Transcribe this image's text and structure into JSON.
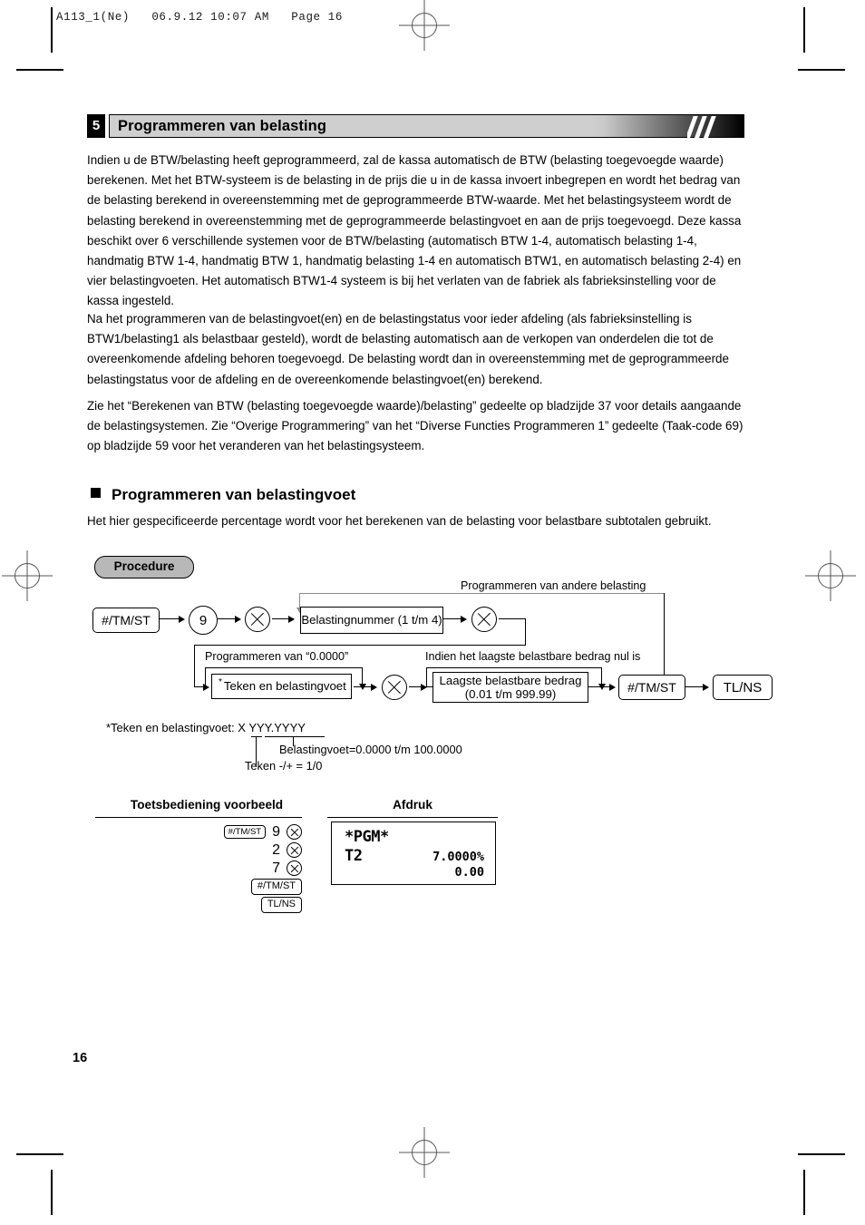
{
  "print_header": {
    "text": "A113_1(Ne)   06.9.12 10:07 AM   Page 16"
  },
  "section": {
    "number": "5",
    "title": "Programmeren van belasting"
  },
  "paragraphs": {
    "p1": "Indien u de BTW/belasting heeft geprogrammeerd, zal de kassa automatisch de BTW (belasting toegevoegde waarde) berekenen. Met het BTW-systeem is de belasting in de prijs die u in de kassa invoert inbegrepen en wordt het bedrag van de belasting berekend in overeenstemming met de geprogrammeerde BTW-waarde. Met het belastingsysteem wordt de belasting berekend in overeenstemming met de geprogrammeerde belastingvoet en aan de prijs toegevoegd. Deze kassa beschikt over 6 verschillende systemen voor de BTW/belasting (automatisch BTW 1-4, automatisch belasting 1-4, handmatig BTW 1-4, handmatig BTW 1, handmatig belasting 1-4 en automatisch BTW1, en automatisch belasting 2-4) en vier belastingvoeten. Het automatisch BTW1-4 systeem is bij het verlaten van de fabriek als fabrieksinstelling voor de kassa ingesteld.",
    "p2": "Na het programmeren van de belastingvoet(en) en de belastingstatus voor ieder afdeling (als fabrieksinstelling is BTW1/belasting1 als belastbaar gesteld), wordt de belasting automatisch aan de verkopen van onderdelen die tot de overeenkomende afdeling behoren toegevoegd. De belasting wordt dan in overeenstemming met de geprogrammeerde belastingstatus voor de afdeling en de overeenkomende belastingvoet(en) berekend.",
    "p3": "Zie het “Berekenen van BTW (belasting toegevoegde waarde)/belasting” gedeelte op bladzijde 37 voor details aangaande de belastingsystemen. Zie “Overige Programmering” van het “Diverse Functies Programmeren 1” gedeelte (Taak-code 69) op bladzijde 59 voor het veranderen van het belastingsysteem."
  },
  "subsection": {
    "heading": "Programmeren van belastingvoet",
    "lead": "Het hier gespecificeerde percentage wordt voor het berekenen van de belasting voor belastbare subtotalen gebruikt.",
    "procedure_label": "Procedure"
  },
  "diagram": {
    "key_start": "#/TM/ST",
    "digit_9": "9",
    "box_tax_number": "Belastingnummer (1 t/m 4)",
    "label_other_tax": "Programmeren van andere belasting",
    "label_program_zero": "Programmeren van “0.0000”",
    "box_sign_rate": "Teken en belastingvoet",
    "sign_rate_asterisk": "*",
    "label_lowest_zero": "Indien het laagste belastbare bedrag nul is",
    "box_lowest_amount_l1": "Laagste belastbare bedrag",
    "box_lowest_amount_l2": "(0.01 t/m 999.99)",
    "key_tmst": "#/TM/ST",
    "key_tlns": "TL/NS"
  },
  "footnote": {
    "main": "*Teken en belastingvoet: X YYY.YYYY",
    "rate_range": "Belastingvoet=0.0000 t/m 100.0000",
    "sign_note": "Teken -/+ = 1/0"
  },
  "example": {
    "key_operation_heading": "Toetsbediening voorbeeld",
    "print_heading": "Afdruk",
    "key_rows": [
      {
        "keys": [
          "#/TM/ST"
        ],
        "digit": "9",
        "multiply": true
      },
      {
        "keys": [],
        "digit": "2",
        "multiply": true
      },
      {
        "keys": [],
        "digit": "7",
        "multiply": true
      },
      {
        "keys": [
          "#/TM/ST"
        ],
        "digit": "",
        "multiply": false
      },
      {
        "keys": [
          "TL/NS"
        ],
        "digit": "",
        "multiply": false
      }
    ],
    "receipt": {
      "title": "*PGM*",
      "line_label": "T2",
      "rate": "7.0000%",
      "amount": "0.00"
    }
  },
  "page_number": "16"
}
